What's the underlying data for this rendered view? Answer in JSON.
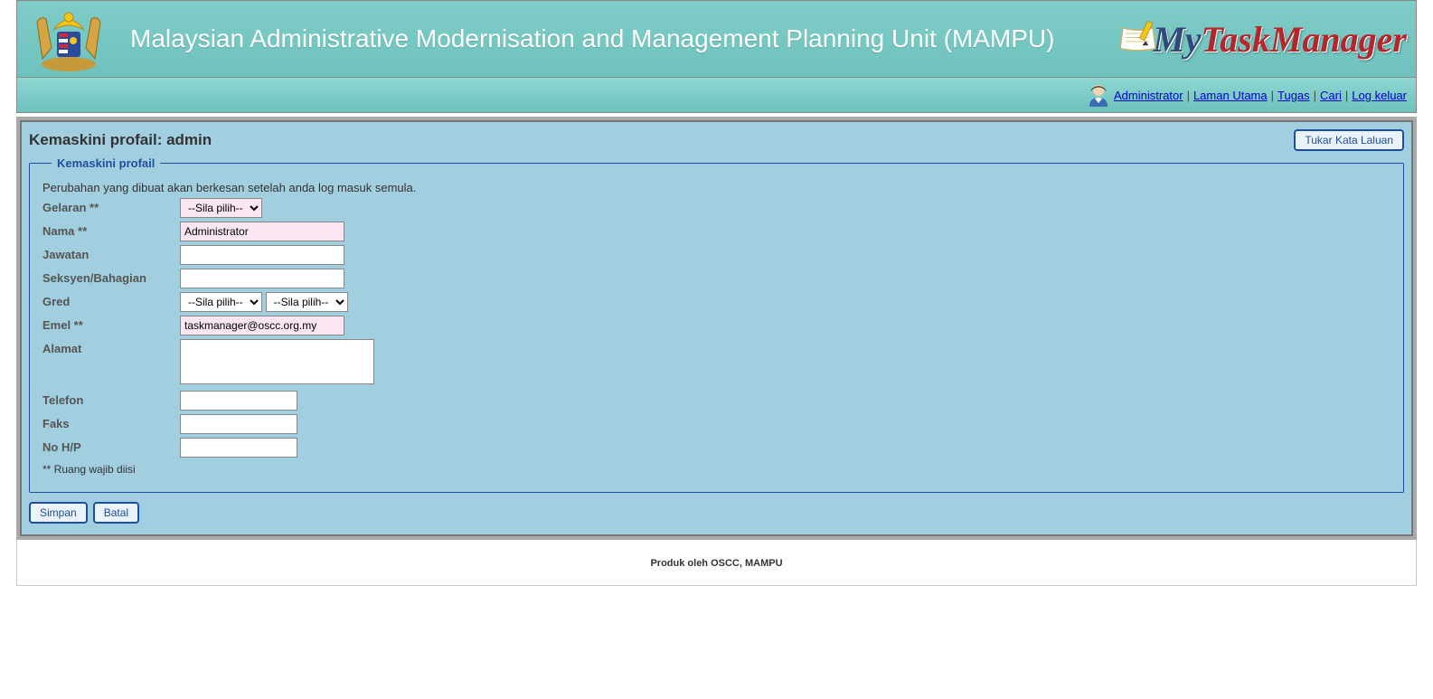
{
  "header": {
    "org_title": "Malaysian Administrative Modernisation and Management Planning Unit (MAMPU)",
    "logo_my": "My",
    "logo_tm": "TaskManager"
  },
  "nav": {
    "admin": "Administrator",
    "home": "Laman Utama",
    "tasks": "Tugas",
    "search": "Cari",
    "logout": "Log keluar"
  },
  "panel": {
    "title": "Kemaskini profail: admin",
    "change_pw": "Tukar Kata Laluan"
  },
  "form": {
    "legend": "Kemaskini profail",
    "note": "Perubahan yang dibuat akan berkesan setelah anda log masuk semula.",
    "fields": {
      "gelaran_label": "Gelaran **",
      "gelaran_value": "--Sila pilih--",
      "nama_label": "Nama **",
      "nama_value": "Administrator",
      "jawatan_label": "Jawatan",
      "jawatan_value": "",
      "seksyen_label": "Seksyen/Bahagian",
      "seksyen_value": "",
      "gred_label": "Gred",
      "gred1_value": "--Sila pilih--",
      "gred2_value": "--Sila pilih--",
      "emel_label": "Emel **",
      "emel_value": "taskmanager@oscc.org.my",
      "alamat_label": "Alamat",
      "alamat_value": "",
      "telefon_label": "Telefon",
      "telefon_value": "",
      "faks_label": "Faks",
      "faks_value": "",
      "nohp_label": "No H/P",
      "nohp_value": ""
    },
    "required_note": "** Ruang wajib diisi"
  },
  "buttons": {
    "save": "Simpan",
    "cancel": "Batal"
  },
  "footer": {
    "text": "Produk oleh OSCC, MAMPU"
  }
}
